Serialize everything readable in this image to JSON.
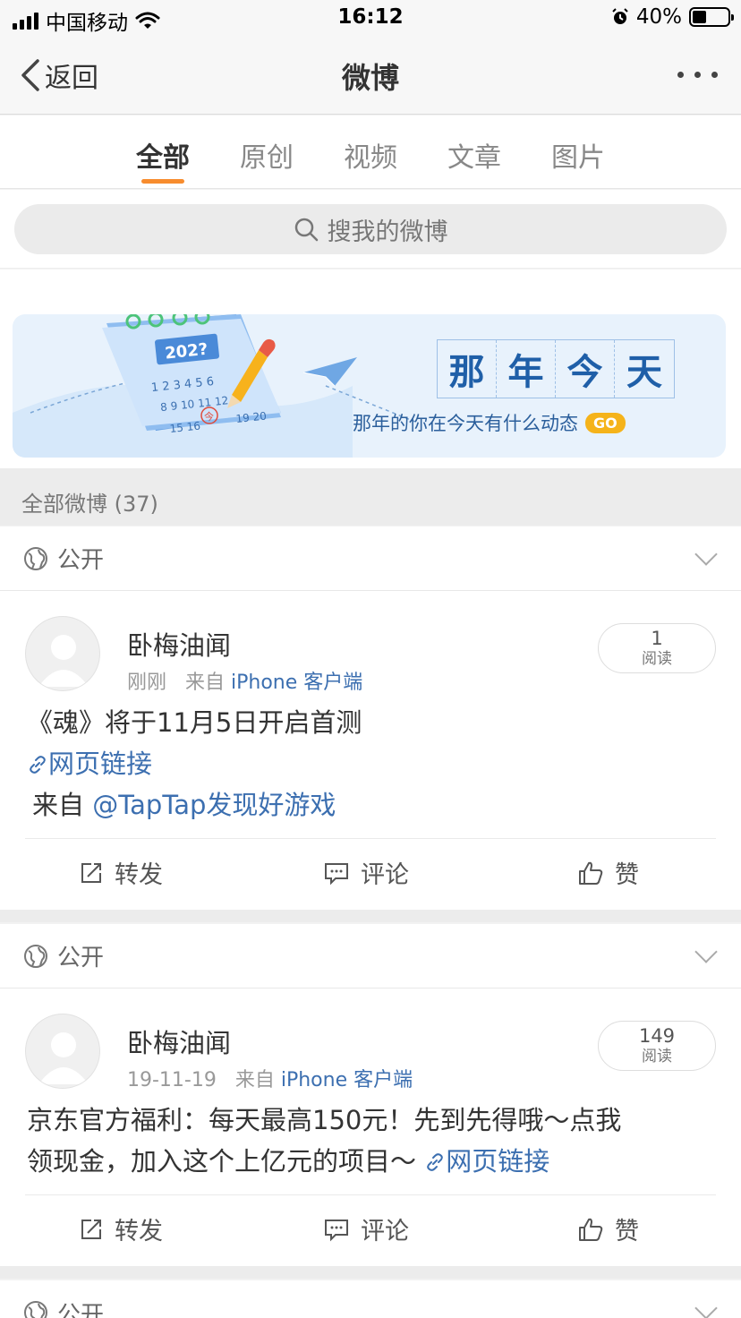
{
  "status_bar": {
    "carrier": "中国移动",
    "time": "16:12",
    "battery": "40%",
    "battery_level": 0.4
  },
  "nav": {
    "back_label": "返回",
    "title": "微博"
  },
  "tabs": [
    {
      "label": "全部",
      "active": true
    },
    {
      "label": "原创",
      "active": false
    },
    {
      "label": "视频",
      "active": false
    },
    {
      "label": "文章",
      "active": false
    },
    {
      "label": "图片",
      "active": false
    }
  ],
  "search": {
    "placeholder": "搜我的微博"
  },
  "banner": {
    "title_chars": [
      "那",
      "年",
      "今",
      "天"
    ],
    "subtitle": "那年的你在今天有什么动态",
    "go_label": "GO",
    "calendar_year": "202?",
    "calendar_days": "1 2 3 4 5 6",
    "calendar_days2": "8 9 10 11 12",
    "calendar_days3": "15 16",
    "calendar_days4": "19 20",
    "calendar_today": "今"
  },
  "section": {
    "label": "全部微博 (37)"
  },
  "posts": [
    {
      "visibility": "公开",
      "author": "卧梅油闻",
      "time": "刚刚",
      "from_prefix": "来自",
      "source": "iPhone 客户端",
      "reads_count": "1",
      "reads_label": "阅读",
      "text_line1": "《魂》将于11月5日开启首测",
      "link_label": "网页链接",
      "from_line_prefix": "来自",
      "from_line_link": "@TapTap发现好游戏",
      "actions": {
        "repost": "转发",
        "comment": "评论",
        "like": "赞"
      }
    },
    {
      "visibility": "公开",
      "author": "卧梅油闻",
      "time": "19-11-19",
      "from_prefix": "来自",
      "source": "iPhone 客户端",
      "reads_count": "149",
      "reads_label": "阅读",
      "text_line1": "京东官方福利：每天最高150元！先到先得哦～点我",
      "text_line2": "领现金，加入这个上亿元的项目～",
      "link_label": "网页链接",
      "actions": {
        "repost": "转发",
        "comment": "评论",
        "like": "赞"
      }
    },
    {
      "visibility": "公开"
    }
  ],
  "colors": {
    "accent": "#f78c2e",
    "link": "#3c6fb0",
    "banner_bg": "#e8f2fc",
    "go": "#f5b31a"
  }
}
